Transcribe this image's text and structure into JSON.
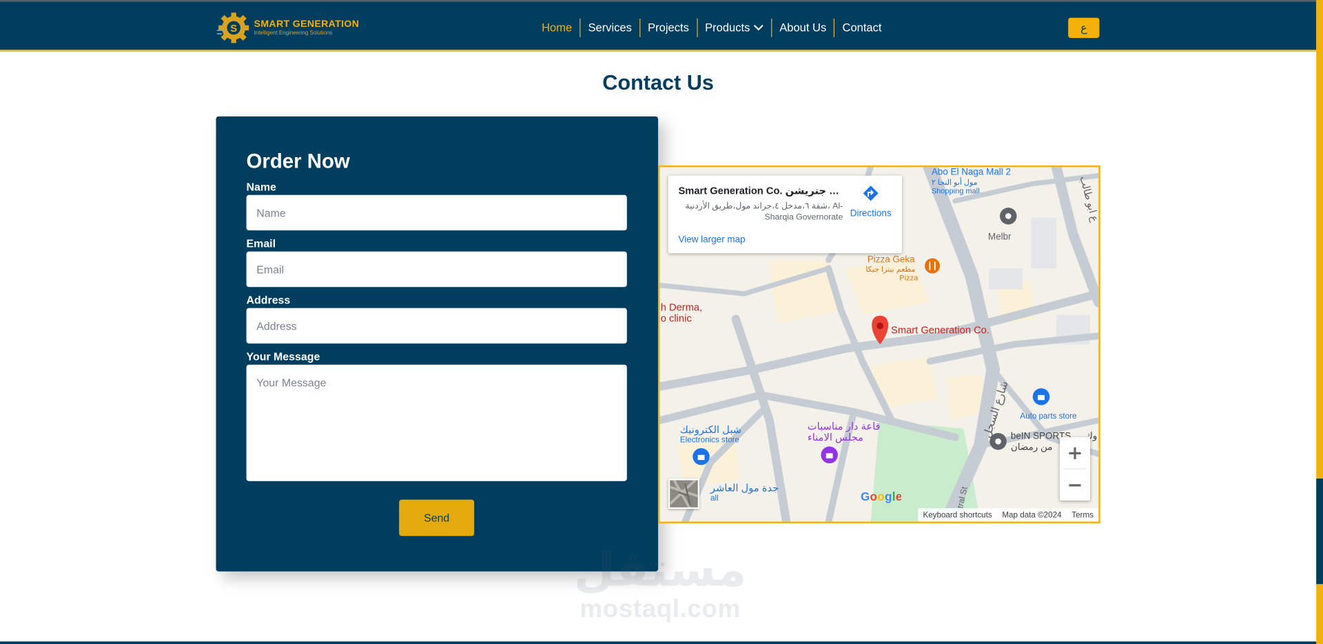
{
  "header": {
    "logo_title": "SMART GENERATION",
    "logo_subtitle": "Intelligent Engineering Solutions",
    "nav": [
      {
        "label": "Home",
        "active": true
      },
      {
        "label": "Services"
      },
      {
        "label": "Projects"
      },
      {
        "label": "Products",
        "dropdown": true
      },
      {
        "label": "About Us"
      },
      {
        "label": "Contact"
      }
    ],
    "lang_button": "ع"
  },
  "page": {
    "title": "Contact Us"
  },
  "form": {
    "title": "Order Now",
    "name_label": "Name",
    "name_placeholder": "Name",
    "name_value": "",
    "email_label": "Email",
    "email_placeholder": "Email",
    "email_value": "",
    "address_label": "Address",
    "address_placeholder": "Address",
    "address_value": "",
    "message_label": "Your Message",
    "message_placeholder": "Your Message",
    "message_value": "",
    "send_label": "Send"
  },
  "map": {
    "card_title": "Smart Generation Co. شركة سمارت جنريشن",
    "card_address": "شقة ٦،مدخل ٤،جراند مول،طريق الأردنية، Al-Sharqia Governorate",
    "directions_label": "Directions",
    "view_larger": "View larger map",
    "places": {
      "abo_el_naga": "Abo El Naga Mall 2",
      "abo_el_naga_ar": "مول أبو النجا ٢",
      "shopping_mall": "Shopping mall",
      "melbr": "Melbr",
      "pizza_geka": "Pizza Geka",
      "pizza_ar": "مطعم بيتزا جيكا",
      "pizza_sub": "Pizza",
      "derma_1": "h Derma,",
      "derma_2": "o clinic",
      "smart_gen": "Smart Generation Co.",
      "street_ar": "شارع السجل",
      "street_en": "tral St",
      "auto_parts": "Auto parts store",
      "bein": "beIN SPORTS",
      "bein_ar": "وك",
      "ramadan_ar": "من رمضان",
      "electronics_ar": "شبل الكترونيك",
      "electronics": "Electronics store",
      "hall_ar_1": "قاعة دار مناسبات",
      "hall_ar_2": "مجلس الامناء",
      "mall_bottom_ar": "جدة مول العاشر",
      "mall_bottom": "all",
      "right_road_ar": "ع ابو طالب"
    },
    "google_logo": "Google",
    "footer": {
      "shortcuts": "Keyboard shortcuts",
      "data": "Map data ©2024",
      "terms": "Terms"
    },
    "colors": {
      "pin": "#ea4335",
      "poi_blue": "#1a73e8",
      "poi_orange": "#e8710a",
      "poi_purple": "#9334e6",
      "park": "#c9eccd"
    }
  },
  "watermark": {
    "arabic": "مستقل",
    "latin": "mostaql.com"
  },
  "colors": {
    "navy": "#003d5e",
    "accent": "#f3b10a"
  }
}
